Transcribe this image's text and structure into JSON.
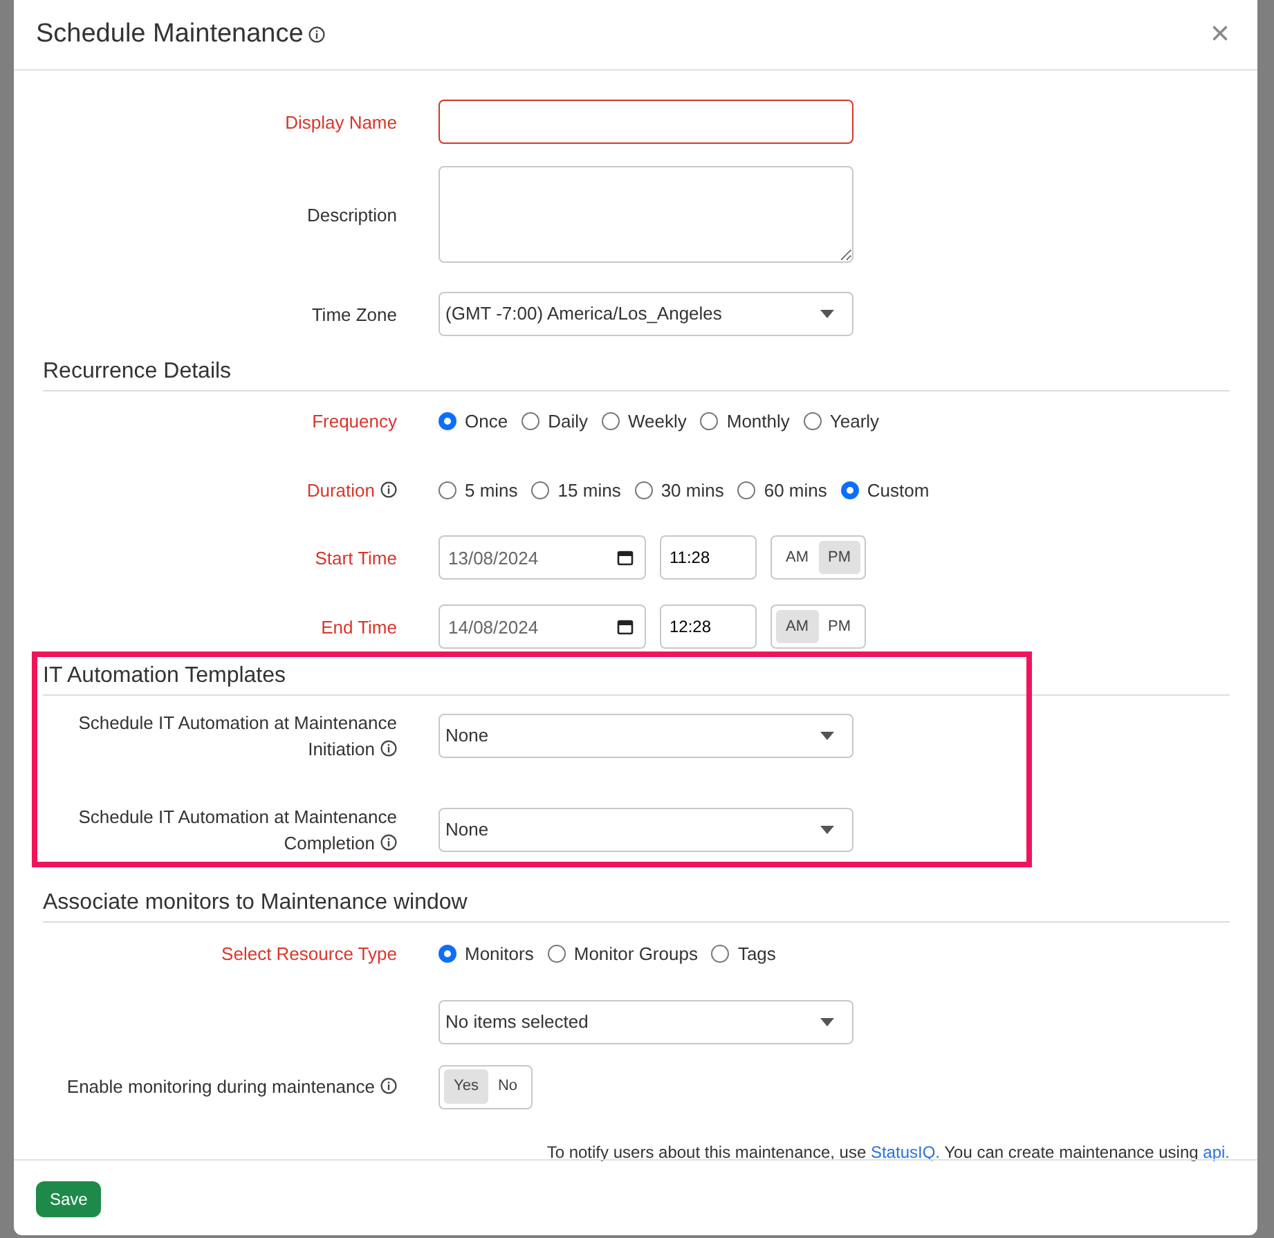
{
  "dialog": {
    "title": "Schedule Maintenance",
    "title_info": true,
    "close": "×",
    "sections": [
      {
        "rows": [
          {
            "kind": "text",
            "label": "Display Name",
            "required": true,
            "value": ""
          },
          {
            "kind": "textarea",
            "label": "Description"
          },
          {
            "kind": "select",
            "label": "Time Zone",
            "value": "(GMT -7:00) America/Los_Angeles"
          }
        ]
      },
      {
        "heading": "Recurrence Details",
        "rows": [
          {
            "kind": "radio",
            "label": "Frequency",
            "required": true,
            "options": [
              {
                "label": "Once",
                "selected": true
              },
              {
                "label": "Daily",
                "selected": false
              },
              {
                "label": "Weekly",
                "selected": false
              },
              {
                "label": "Monthly",
                "selected": false
              },
              {
                "label": "Yearly",
                "selected": false
              }
            ]
          },
          {
            "kind": "radio",
            "label": "Duration",
            "required": true,
            "info": true,
            "options": [
              {
                "label": "5 mins",
                "selected": false
              },
              {
                "label": "15 mins",
                "selected": false
              },
              {
                "label": "30 mins",
                "selected": false
              },
              {
                "label": "60 mins",
                "selected": false
              },
              {
                "label": "Custom",
                "selected": true
              }
            ]
          },
          {
            "kind": "datetime",
            "label": "Start Time",
            "required": true,
            "date": "13/08/2024",
            "time": "11:28",
            "periods": [
              {
                "label": "AM",
                "selected": false
              },
              {
                "label": "PM",
                "selected": true
              }
            ]
          },
          {
            "kind": "datetime",
            "label": "End Time",
            "required": true,
            "date": "14/08/2024",
            "time": "12:28",
            "periods": [
              {
                "label": "AM",
                "selected": true
              },
              {
                "label": "PM",
                "selected": false
              }
            ]
          }
        ]
      },
      {
        "heading": "IT Automation Templates",
        "highlighted": true,
        "rows": [
          {
            "kind": "select",
            "label": "Schedule IT Automation at Maintenance Initiation",
            "info": true,
            "value": "None"
          },
          {
            "kind": "select",
            "label": "Schedule IT Automation at Maintenance Completion",
            "info": true,
            "value": "None"
          }
        ]
      },
      {
        "heading": "Associate monitors to Maintenance window",
        "rows": [
          {
            "kind": "radio",
            "label": "Select Resource Type",
            "required": true,
            "options": [
              {
                "label": "Monitors",
                "selected": true
              },
              {
                "label": "Monitor Groups",
                "selected": false
              },
              {
                "label": "Tags",
                "selected": false
              }
            ]
          },
          {
            "kind": "select",
            "value": "No items selected"
          },
          {
            "kind": "toggle",
            "label": "Enable monitoring during maintenance",
            "info": true,
            "options": [
              {
                "label": "Yes",
                "selected": true
              },
              {
                "label": "No",
                "selected": false
              }
            ]
          }
        ]
      }
    ],
    "notice": [
      {
        "text": "To notify users about this maintenance, use ",
        "link": false
      },
      {
        "text": "StatusIQ.",
        "link": true
      },
      {
        "text": " You can create maintenance using ",
        "link": false
      },
      {
        "text": "api.",
        "link": true
      }
    ],
    "buttons": [
      {
        "label": "Save",
        "kind": "primary"
      }
    ]
  }
}
